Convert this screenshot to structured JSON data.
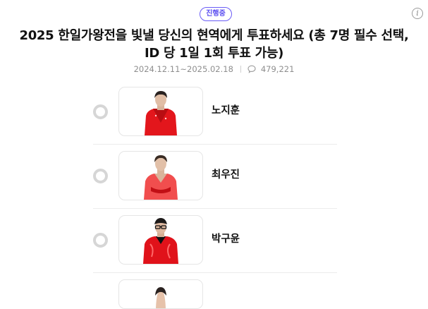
{
  "poll": {
    "status_badge": "진행중",
    "title": "2025 한일가왕전을 빛낼 당신의 현역에게 투표하세요 (총 7명 필수 선택, ID 당 1일 1회 투표 가능)",
    "period": "2024.12.11~2025.02.18",
    "comment_count": "479,221"
  },
  "icons": {
    "info": "info-circle-icon",
    "comment": "speech-bubble-icon"
  },
  "candidates": [
    {
      "name": "노지훈"
    },
    {
      "name": "최우진"
    },
    {
      "name": "박구윤"
    }
  ],
  "colors": {
    "accent": "#5b4ef0",
    "outfit_red": "#e3161c",
    "radio_border": "#d6d6d6"
  }
}
